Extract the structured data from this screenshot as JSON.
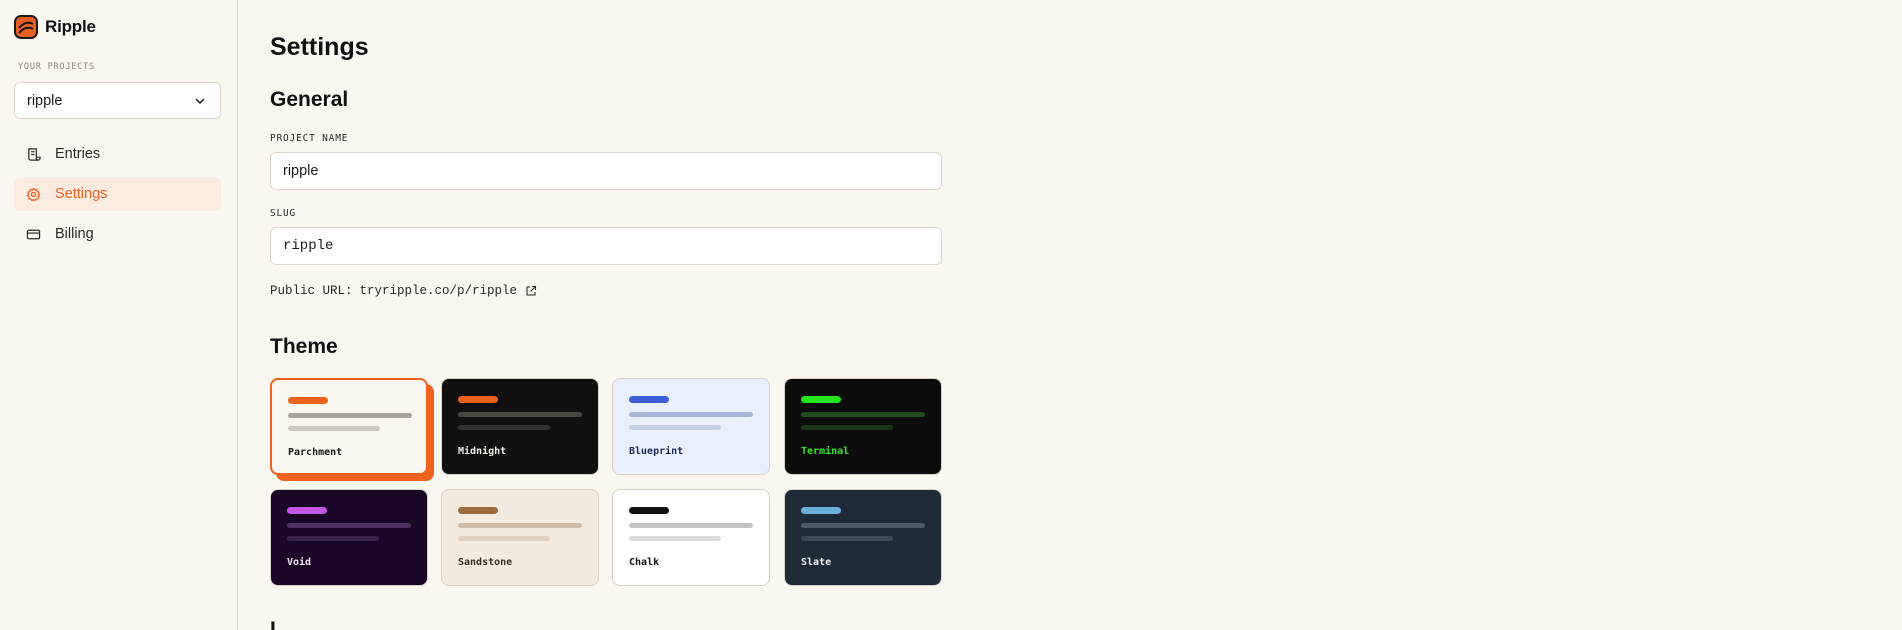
{
  "brand": {
    "name": "Ripple",
    "color": "#ea5f22"
  },
  "sidebar": {
    "projects_label": "YOUR PROJECTS",
    "project_select": {
      "value": "ripple"
    },
    "items": [
      {
        "label": "Entries",
        "icon": "scroll-icon",
        "active": false
      },
      {
        "label": "Settings",
        "icon": "gear-icon",
        "active": true
      },
      {
        "label": "Billing",
        "icon": "credit-card-icon",
        "active": false
      }
    ]
  },
  "main": {
    "title": "Settings",
    "general": {
      "heading": "General",
      "project_name_label": "PROJECT NAME",
      "project_name_value": "ripple",
      "slug_label": "SLUG",
      "slug_value": "ripple",
      "public_url_label": "Public URL:",
      "public_url_value": "tryripple.co/p/ripple"
    },
    "theme": {
      "heading": "Theme",
      "selected": "Parchment",
      "options": [
        {
          "name": "Parchment",
          "bg": "#faf6f0",
          "accent": "#f0631f",
          "line1": "#a8a39c",
          "line2": "#cdc8c1",
          "text": "#1a1a1a"
        },
        {
          "name": "Midnight",
          "bg": "#12100e",
          "accent": "#f0631f",
          "line1": "#4a4642",
          "line2": "#35322f",
          "text": "#f2efe9"
        },
        {
          "name": "Blueprint",
          "bg": "#eaf0fb",
          "accent": "#3a5fd9",
          "line1": "#a7b5d8",
          "line2": "#c5cfe6",
          "text": "#1c2a55"
        },
        {
          "name": "Terminal",
          "bg": "#0b0c0b",
          "accent": "#22e51b",
          "line1": "#1f4b1d",
          "line2": "#173816",
          "text": "#35e82c"
        },
        {
          "name": "Void",
          "bg": "#1a0626",
          "accent": "#c257e6",
          "line1": "#4c2f5c",
          "line2": "#3b2447",
          "text": "#f0e6f5"
        },
        {
          "name": "Sandstone",
          "bg": "#f3ebe0",
          "accent": "#9c6b3e",
          "line1": "#d0bba4",
          "line2": "#dfd0bf",
          "text": "#3b2d20"
        },
        {
          "name": "Chalk",
          "bg": "#ffffff",
          "accent": "#111111",
          "line1": "#c4c4c4",
          "line2": "#dcdcdc",
          "text": "#111111"
        },
        {
          "name": "Slate",
          "bg": "#1f2a38",
          "accent": "#6aaedb",
          "line1": "#4b5868",
          "line2": "#3d4957",
          "text": "#eef2f6"
        }
      ]
    },
    "next_heading_partial": "L"
  }
}
